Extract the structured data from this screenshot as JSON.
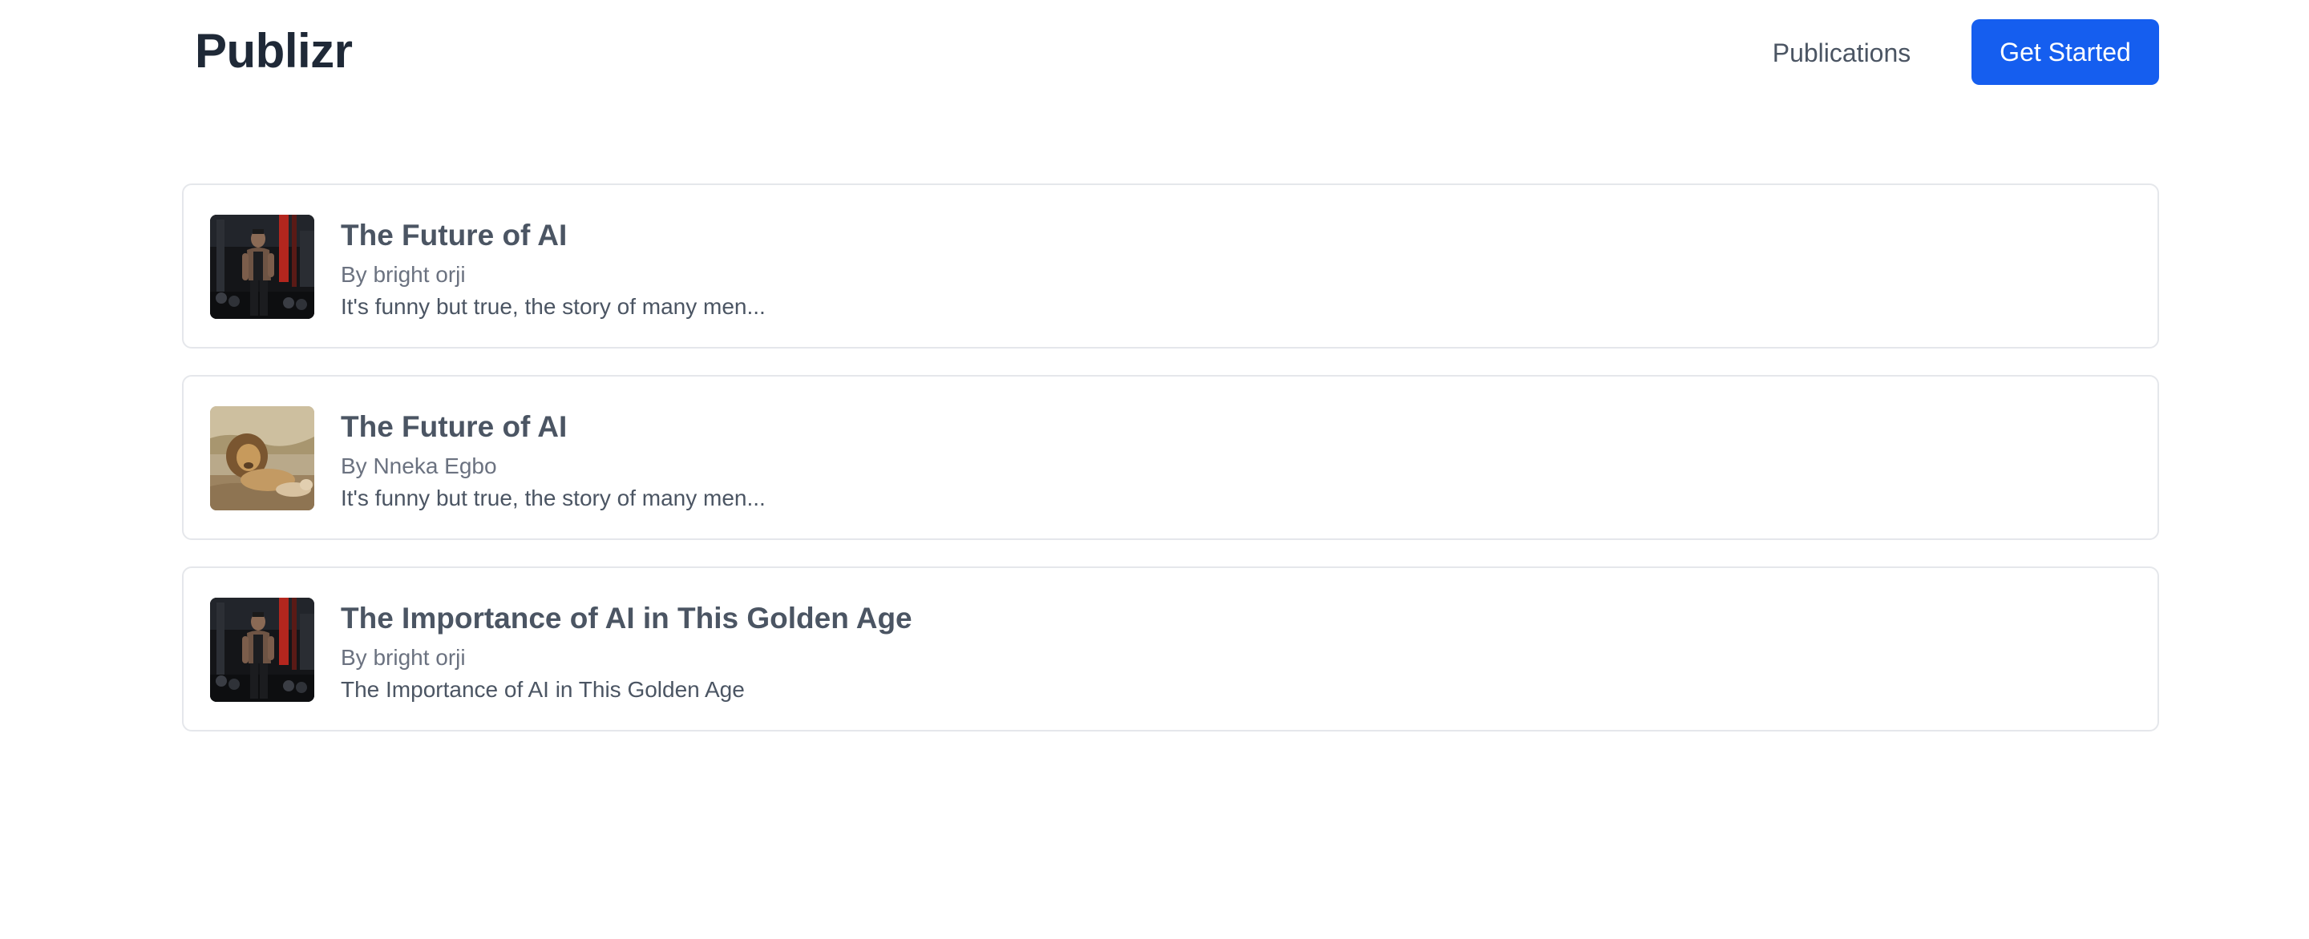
{
  "header": {
    "brand": "Publizr",
    "nav_publications": "Publications",
    "cta_label": "Get Started",
    "accent_color": "#155eef"
  },
  "posts": [
    {
      "title": "The Future of AI",
      "author": "By bright orji",
      "excerpt": "It's funny but true, the story of many men...",
      "thumbnail": "gym-photo"
    },
    {
      "title": "The Future of AI",
      "author": "By Nneka Egbo",
      "excerpt": "It's funny but true, the story of many men...",
      "thumbnail": "lion-photo"
    },
    {
      "title": "The Importance of AI in This Golden Age",
      "author": "By bright orji",
      "excerpt": "The Importance of AI in This Golden Age",
      "thumbnail": "gym-photo"
    }
  ]
}
